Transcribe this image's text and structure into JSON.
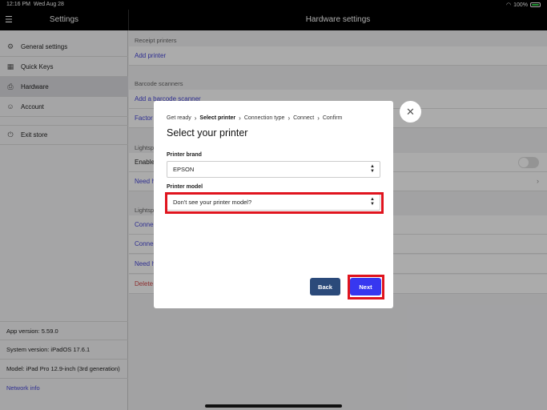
{
  "status": {
    "time": "12:16 PM",
    "date": "Wed Aug 28",
    "battery": "100%"
  },
  "header": {
    "left_title": "Settings",
    "main_title": "Hardware settings"
  },
  "sidebar": {
    "items": [
      {
        "label": "General settings",
        "icon": "gear-icon"
      },
      {
        "label": "Quick Keys",
        "icon": "grid-icon"
      },
      {
        "label": "Hardware",
        "icon": "printer-icon"
      },
      {
        "label": "Account",
        "icon": "person-icon"
      },
      {
        "label": "Exit store",
        "icon": "power-icon"
      }
    ],
    "footer": {
      "app_version": "App version: 5.59.0",
      "system_version": "System version: iPadOS 17.6.1",
      "model": "Model: iPad Pro 12.9-inch (3rd generation)",
      "network_info": "Network info"
    }
  },
  "main": {
    "receipt_printers": {
      "header": "Receipt printers",
      "add": "Add printer"
    },
    "barcode_scanners": {
      "header": "Barcode scanners",
      "add": "Add a barcode scanner",
      "factory": "Factor"
    },
    "lightspeed1": {
      "header": "Lightsp",
      "enable": "Enable",
      "need": "Need h"
    },
    "lightspeed2": {
      "header": "Lightsp",
      "connect1": "Conne",
      "connect2": "Conne",
      "need": "Need h",
      "delete": "Delete"
    }
  },
  "modal": {
    "breadcrumb": [
      "Get ready",
      "Select printer",
      "Connection type",
      "Connect",
      "Confirm"
    ],
    "title": "Select your printer",
    "brand_label": "Printer brand",
    "brand_value": "EPSON",
    "model_label": "Printer model",
    "model_value": "Don't see your printer model?",
    "back": "Back",
    "next": "Next"
  },
  "colors": {
    "accent": "#3737f0",
    "back": "#2b4a7a",
    "highlight": "#e0141e",
    "link": "#4646d8"
  }
}
